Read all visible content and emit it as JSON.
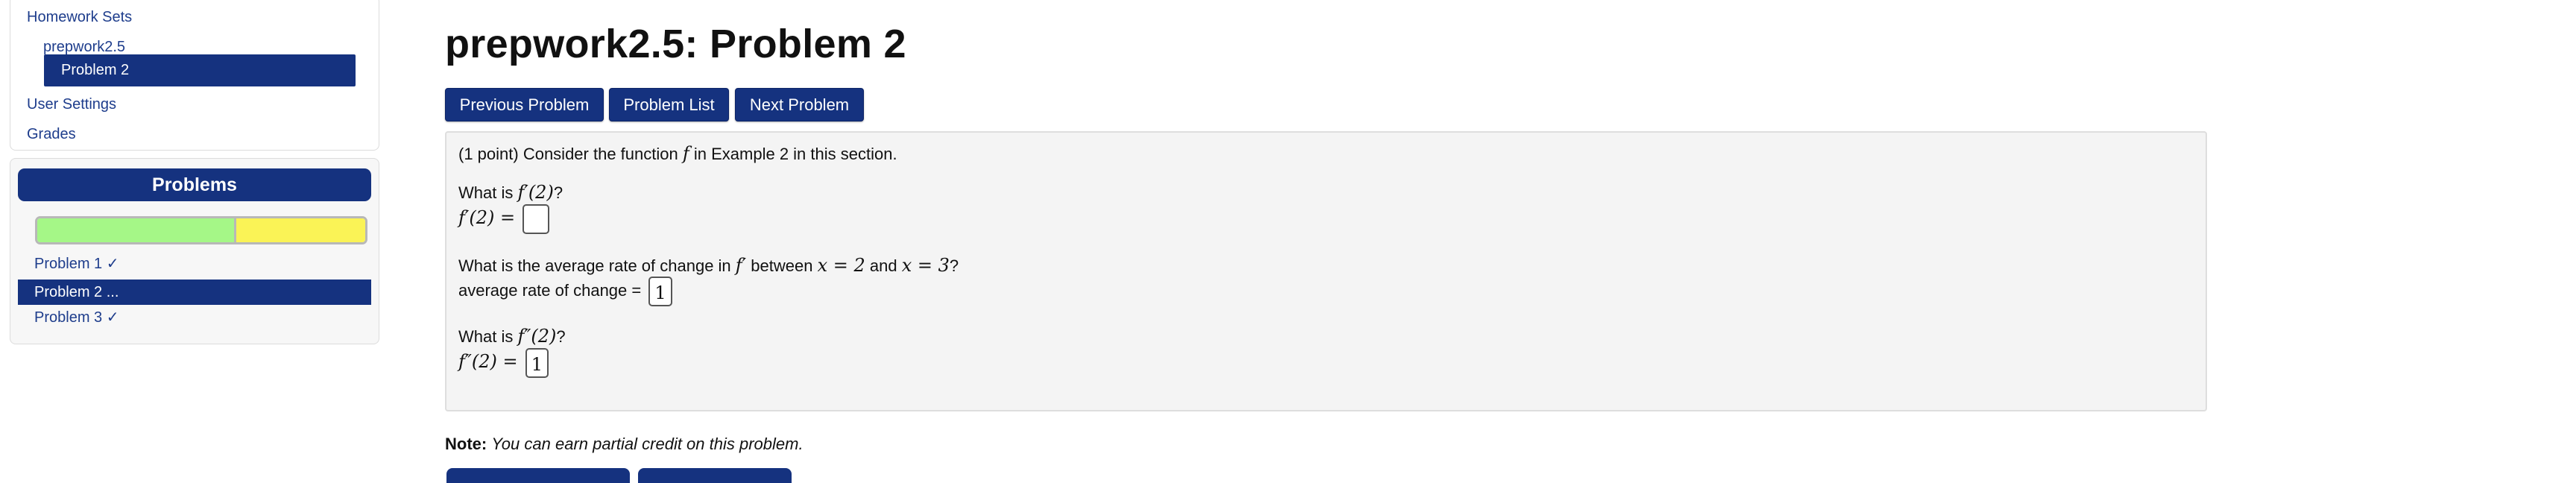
{
  "sidebar": {
    "nav": {
      "homework_sets": "Homework Sets",
      "set_name": "prepwork2.5",
      "current_problem": "Problem 2",
      "user_settings": "User Settings",
      "grades": "Grades"
    },
    "problems": {
      "header": "Problems",
      "progress": {
        "correct_fraction": 0.6,
        "partial_fraction": 0.4,
        "correct_color": "#a5f787",
        "partial_color": "#faf356"
      },
      "items": [
        {
          "label": "Problem 1 ✓"
        },
        {
          "label": "Problem 2 ..."
        },
        {
          "label": "Problem 3 ✓"
        }
      ]
    }
  },
  "main": {
    "title": "prepwork2.5: Problem 2",
    "buttons": {
      "previous": "Previous Problem",
      "list": "Problem List",
      "next": "Next Problem"
    },
    "problem": {
      "intro_prefix": "(1 point) Consider the function",
      "intro_var": "f",
      "intro_suffix": "in Example 2 in this section.",
      "q1": {
        "prompt_prefix": "What is",
        "prompt_math": "f′(2)",
        "prompt_suffix": "?",
        "answer_label": "f′(2) =",
        "answer_value": ""
      },
      "q2": {
        "prompt_prefix": "What is the average rate of change in",
        "prompt_var": "f′",
        "prompt_between": "between",
        "prompt_x1": "x = 2",
        "prompt_and": "and",
        "prompt_x2": "x = 3",
        "prompt_suffix": "?",
        "answer_label": "average rate of change =",
        "answer_value": "1"
      },
      "q3": {
        "prompt_prefix": "What is",
        "prompt_math": "f″(2)",
        "prompt_suffix": "?",
        "answer_label": "f″(2) =",
        "answer_value": "1"
      }
    },
    "note": {
      "label": "Note:",
      "text": "You can earn partial credit on this problem."
    }
  },
  "colors": {
    "accent": "#15327f",
    "link": "#1e3d8c",
    "problem_bg": "#f4f4f4"
  }
}
